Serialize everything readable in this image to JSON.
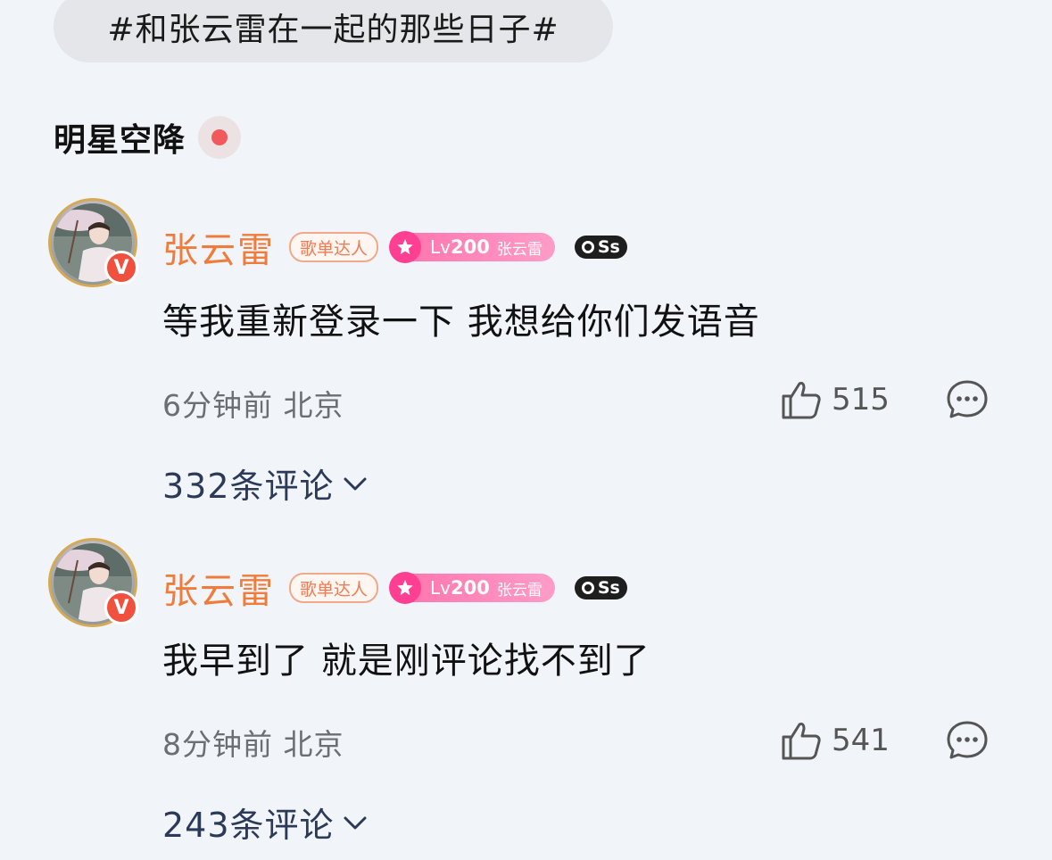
{
  "topic_tag": "#和张云雷在一起的那些日子#",
  "section": {
    "title": "明星空降"
  },
  "comments": [
    {
      "username": "张云雷",
      "verified_badge": "V",
      "badge_songlist": "歌单达人",
      "level_badge": {
        "lv": "Lv",
        "num": "200",
        "name": "张云雷"
      },
      "ss_badge": "Ss",
      "text": "等我重新登录一下 我想给你们发语音",
      "time": "6分钟前",
      "location": "北京",
      "likes": "515",
      "replies": "332条评论"
    },
    {
      "username": "张云雷",
      "verified_badge": "V",
      "badge_songlist": "歌单达人",
      "level_badge": {
        "lv": "Lv",
        "num": "200",
        "name": "张云雷"
      },
      "ss_badge": "Ss",
      "text": "我早到了 就是刚评论找不到了",
      "time": "8分钟前",
      "location": "北京",
      "likes": "541",
      "replies": "243条评论"
    }
  ],
  "colors": {
    "background": "#f1f5f9",
    "username": "#f07c3c",
    "replies_link": "#2c3a5a",
    "live_dot": "#f05a5a",
    "level_badge": "#ff72ac",
    "verified": "#f0513f"
  },
  "icons": [
    "live-dot-icon",
    "star-icon",
    "thumb-up-icon",
    "comment-bubble-icon",
    "chevron-down-icon",
    "verified-v-icon"
  ]
}
